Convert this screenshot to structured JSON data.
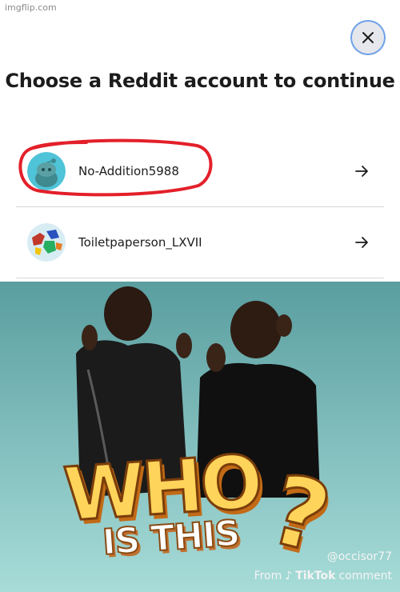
{
  "watermark": "imgflip.com",
  "dialog": {
    "title": "Choose a Reddit account to continue",
    "close_icon": "close-icon",
    "accounts": [
      {
        "name": "No-Addition5988",
        "icon": "arrow-right-icon",
        "avatar": "snoo-avatar",
        "highlighted": true
      },
      {
        "name": "Toiletpaperson_LXVII",
        "icon": "arrow-right-icon",
        "avatar": "map-avatar",
        "highlighted": false
      }
    ]
  },
  "meme": {
    "line1": "WHO",
    "line2": "IS THIS",
    "qmark": "?",
    "handle": "@occisor77",
    "credit_prefix": "From",
    "credit_brand": "TikTok",
    "credit_suffix": "comment",
    "colors": {
      "text_yellow": "#ffd45a",
      "outline": "#7a3d0a",
      "bg_teal": "#8fd0cd"
    }
  },
  "colors": {
    "highlight_red": "#e3202a",
    "focus_blue": "#6fa2e6"
  }
}
